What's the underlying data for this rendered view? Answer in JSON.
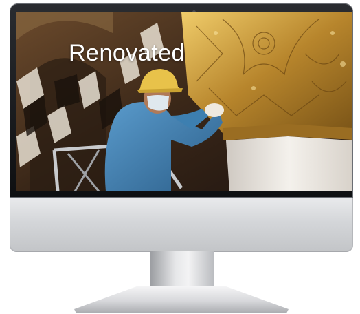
{
  "video": {
    "caption": "Renovated"
  },
  "colors": {
    "bezel": "#1a1b1e",
    "chin": "#d4d6d9",
    "gold": "#c79a3c",
    "worker_shirt": "#3d7fb0",
    "hard_hat": "#e8c24a"
  }
}
